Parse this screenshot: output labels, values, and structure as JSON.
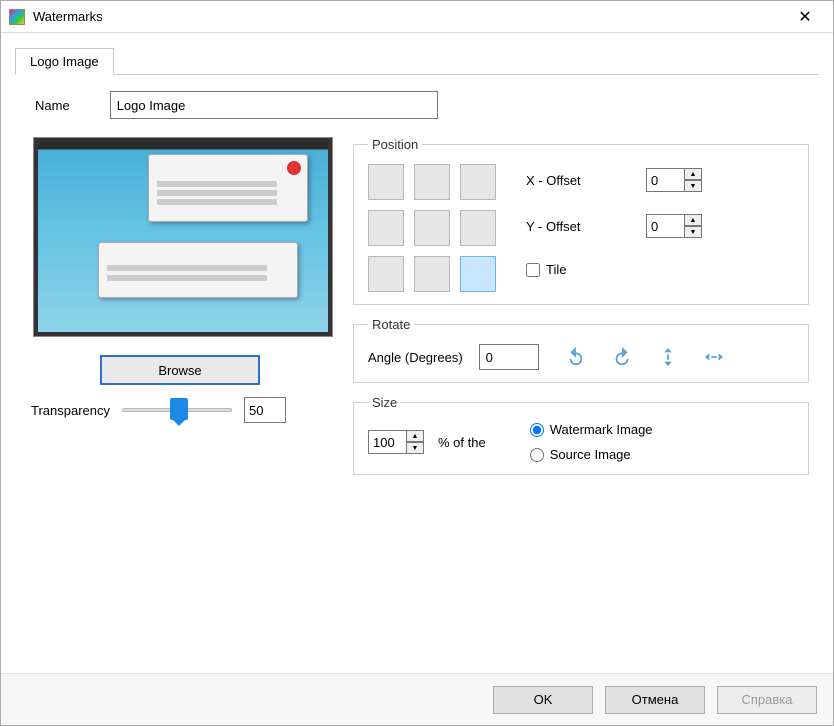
{
  "window": {
    "title": "Watermarks"
  },
  "tab": {
    "label": "Logo Image"
  },
  "name": {
    "label": "Name",
    "value": "Logo Image"
  },
  "browse": {
    "label": "Browse"
  },
  "transparency": {
    "label": "Transparency",
    "value": "50"
  },
  "position": {
    "legend": "Position",
    "x_label": "X - Offset",
    "y_label": "Y - Offset",
    "x_value": "0",
    "y_value": "0",
    "tile_label": "Tile"
  },
  "rotate": {
    "legend": "Rotate",
    "angle_label": "Angle (Degrees)",
    "angle_value": "0"
  },
  "size": {
    "legend": "Size",
    "percent_value": "100",
    "percent_label": "% of the",
    "option_watermark": "Watermark Image",
    "option_source": "Source Image"
  },
  "buttons": {
    "ok": "OK",
    "cancel": "Отмена",
    "help": "Справка"
  }
}
